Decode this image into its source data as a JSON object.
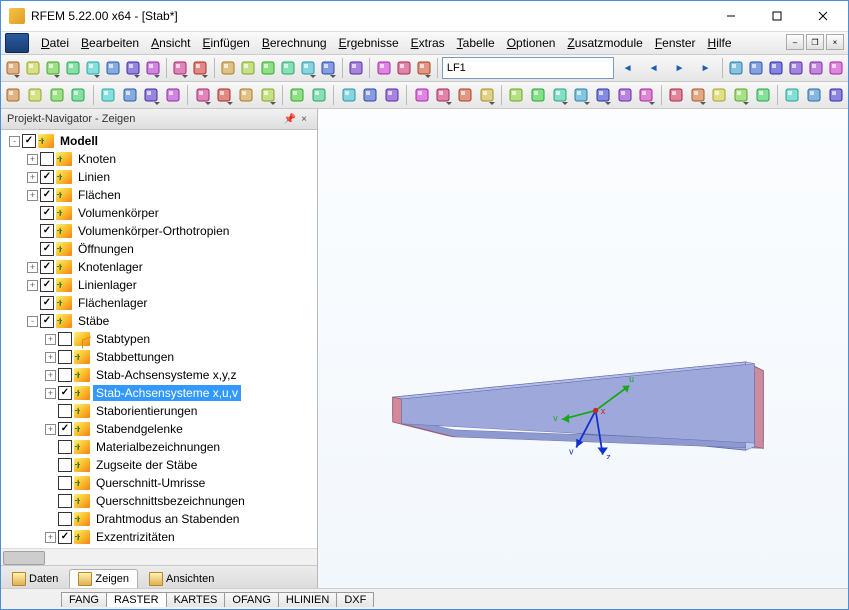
{
  "title": "RFEM 5.22.00 x64 - [Stab*]",
  "menus": [
    "Datei",
    "Bearbeiten",
    "Ansicht",
    "Einfügen",
    "Berechnung",
    "Ergebnisse",
    "Extras",
    "Tabelle",
    "Optionen",
    "Zusatzmodule",
    "Fenster",
    "Hilfe"
  ],
  "loadcase": "LF1",
  "navigator": {
    "title": "Projekt-Navigator - Zeigen",
    "tabs": [
      {
        "label": "Daten",
        "active": false
      },
      {
        "label": "Zeigen",
        "active": true
      },
      {
        "label": "Ansichten",
        "active": false
      }
    ]
  },
  "tree": [
    {
      "d": 0,
      "exp": "-",
      "chk": true,
      "icon": "g",
      "label": "Modell",
      "bold": true
    },
    {
      "d": 1,
      "exp": "+",
      "chk": false,
      "icon": "g",
      "label": "Knoten"
    },
    {
      "d": 1,
      "exp": "+",
      "chk": true,
      "icon": "g",
      "label": "Linien"
    },
    {
      "d": 1,
      "exp": "+",
      "chk": true,
      "icon": "g",
      "label": "Flächen"
    },
    {
      "d": 1,
      "exp": "",
      "chk": true,
      "icon": "g",
      "label": "Volumenkörper"
    },
    {
      "d": 1,
      "exp": "",
      "chk": true,
      "icon": "g",
      "label": "Volumenkörper-Orthotropien"
    },
    {
      "d": 1,
      "exp": "",
      "chk": true,
      "icon": "g",
      "label": "Öffnungen"
    },
    {
      "d": 1,
      "exp": "+",
      "chk": true,
      "icon": "g",
      "label": "Knotenlager"
    },
    {
      "d": 1,
      "exp": "+",
      "chk": true,
      "icon": "g",
      "label": "Linienlager"
    },
    {
      "d": 1,
      "exp": "",
      "chk": true,
      "icon": "g",
      "label": "Flächenlager"
    },
    {
      "d": 1,
      "exp": "-",
      "chk": true,
      "icon": "g",
      "label": "Stäbe"
    },
    {
      "d": 2,
      "exp": "+",
      "chk": false,
      "icon": "y",
      "label": "Stabtypen"
    },
    {
      "d": 2,
      "exp": "+",
      "chk": false,
      "icon": "g",
      "label": "Stabbettungen"
    },
    {
      "d": 2,
      "exp": "+",
      "chk": false,
      "icon": "g",
      "label": "Stab-Achsensysteme x,y,z"
    },
    {
      "d": 2,
      "exp": "+",
      "chk": true,
      "icon": "g",
      "label": "Stab-Achsensysteme x,u,v",
      "sel": true
    },
    {
      "d": 2,
      "exp": "",
      "chk": false,
      "icon": "g",
      "label": "Staborientierungen"
    },
    {
      "d": 2,
      "exp": "+",
      "chk": true,
      "icon": "g",
      "label": "Stabendgelenke"
    },
    {
      "d": 2,
      "exp": "",
      "chk": false,
      "icon": "g",
      "label": "Materialbezeichnungen"
    },
    {
      "d": 2,
      "exp": "",
      "chk": false,
      "icon": "g",
      "label": "Zugseite der Stäbe"
    },
    {
      "d": 2,
      "exp": "",
      "chk": false,
      "icon": "g",
      "label": "Querschnitt-Umrisse"
    },
    {
      "d": 2,
      "exp": "",
      "chk": false,
      "icon": "g",
      "label": "Querschnittsbezeichnungen"
    },
    {
      "d": 2,
      "exp": "",
      "chk": false,
      "icon": "g",
      "label": "Drahtmodus an Stabenden"
    },
    {
      "d": 2,
      "exp": "+",
      "chk": true,
      "icon": "g",
      "label": "Exzentrizitäten"
    }
  ],
  "status_tabs": [
    "FANG",
    "RASTER",
    "KARTES",
    "OFANG",
    "HLINIEN",
    "DXF"
  ],
  "status_active": "RASTER",
  "axes": {
    "u": "u",
    "v": "v",
    "z": "z",
    "x": "x"
  },
  "toolbar1_icons": [
    "new",
    "open",
    "model",
    "save",
    "save-as",
    "page",
    "copy",
    "print",
    "sep",
    "undo",
    "redo",
    "sep",
    "pick",
    "select-rect",
    "zoom-win",
    "zoom-extents",
    "zoom-prev",
    "zoom-sel",
    "sep",
    "grid",
    "sep",
    "layers",
    "view1",
    "view-toggle",
    "sep"
  ],
  "toolbar2_icons": [
    "node",
    "line",
    "node2",
    "curve",
    "sep",
    "support",
    "support-b",
    "support-c",
    "support-d",
    "sep",
    "load-node",
    "load-line",
    "load-area",
    "load-b",
    "sep",
    "material",
    "section",
    "sep",
    "mesh",
    "results",
    "results2",
    "sep",
    "tools-a",
    "tools-b",
    "tools-c",
    "tools-d",
    "sep",
    "r1",
    "r2",
    "r3",
    "r4",
    "r5",
    "r6",
    "r7",
    "sep",
    "zoom-a",
    "zoom-b",
    "zoom-c",
    "rotate",
    "pan",
    "sep",
    "view-a",
    "view-b",
    "view-c"
  ]
}
